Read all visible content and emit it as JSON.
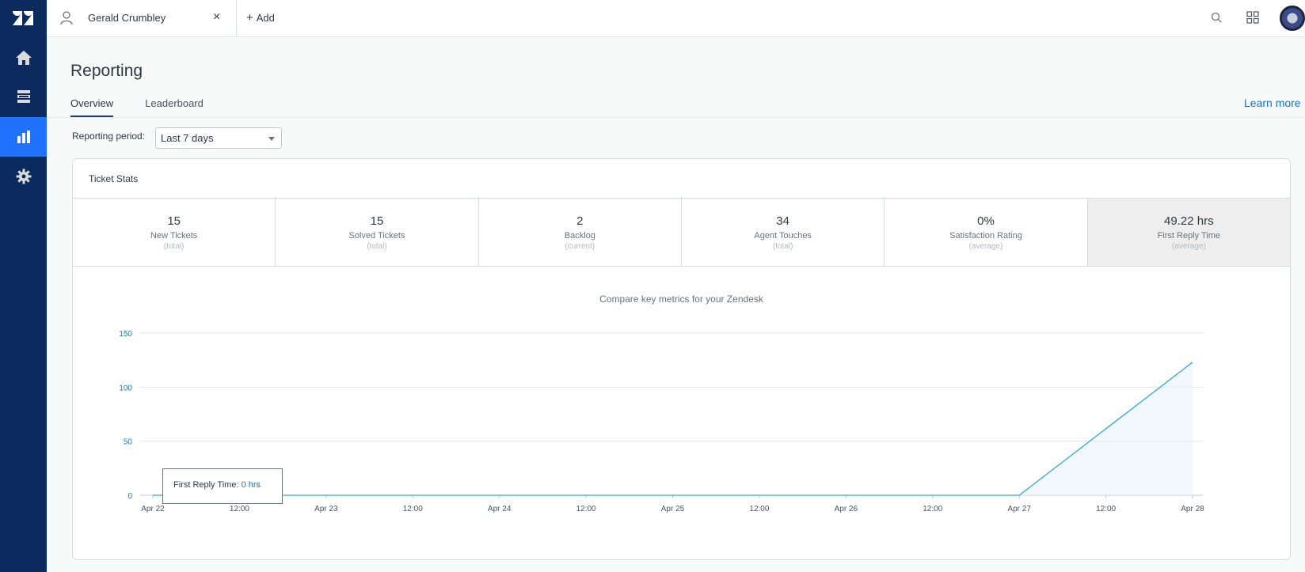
{
  "topbar": {
    "user_tab_name": "Gerald Crumbley",
    "close_glyph": "×",
    "add_label": "Add",
    "add_glyph": "+"
  },
  "nav": {
    "items": [
      "logo-icon",
      "home-icon",
      "views-icon",
      "reporting-icon",
      "settings-icon"
    ],
    "active": "reporting-icon"
  },
  "page": {
    "title": "Reporting",
    "tabs": [
      {
        "label": "Overview",
        "active": true
      },
      {
        "label": "Leaderboard",
        "active": false
      }
    ],
    "learn_more": "Learn more",
    "period_label": "Reporting period:",
    "period_value": "Last 7 days"
  },
  "card": {
    "title": "Ticket Stats",
    "stats": [
      {
        "value": "15",
        "label": "New Tickets",
        "sub": "(total)"
      },
      {
        "value": "15",
        "label": "Solved Tickets",
        "sub": "(total)"
      },
      {
        "value": "2",
        "label": "Backlog",
        "sub": "(current)"
      },
      {
        "value": "34",
        "label": "Agent Touches",
        "sub": "(total)"
      },
      {
        "value": "0%",
        "label": "Satisfaction Rating",
        "sub": "(average)"
      },
      {
        "value": "49.22 hrs",
        "label": "First Reply Time",
        "sub": "(average)"
      }
    ],
    "chart_heading": "Compare key metrics for your Zendesk",
    "tooltip": {
      "label": "First Reply Time:",
      "value": "0 hrs"
    }
  },
  "colors": {
    "nav_bg": "#0b2a5e",
    "nav_active": "#1f73ff",
    "line": "#30a8d8",
    "link": "#1f73b7"
  },
  "chart_data": {
    "type": "area",
    "title": "Compare key metrics for your Zendesk",
    "xlabel": "",
    "ylabel": "",
    "ylim": [
      0,
      150
    ],
    "yticks": [
      0,
      50,
      100,
      150
    ],
    "xtick_labels": [
      "Apr 22",
      "12:00",
      "Apr 23",
      "12:00",
      "Apr 24",
      "12:00",
      "Apr 25",
      "12:00",
      "Apr 26",
      "12:00",
      "Apr 27",
      "12:00",
      "Apr 28"
    ],
    "series": [
      {
        "name": "First Reply Time",
        "x": [
          "Apr 22",
          "Apr 23",
          "Apr 24",
          "Apr 25",
          "Apr 26",
          "Apr 27",
          "Apr 28"
        ],
        "values": [
          0,
          0,
          0,
          0,
          0,
          0,
          123
        ]
      }
    ],
    "grid": true
  }
}
